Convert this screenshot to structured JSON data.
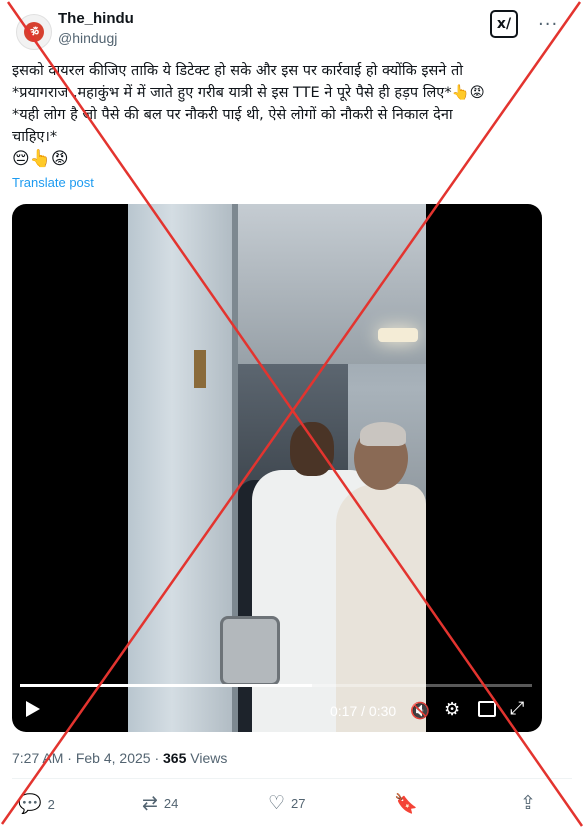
{
  "author": {
    "display_name": "The_hindu",
    "handle": "@hindugj",
    "avatar_icon": "om-logo-icon"
  },
  "toolbar": {
    "grok_label": "x/",
    "more_label": "···"
  },
  "post": {
    "lines": [
      "इसको वायरल कीजिए ताकि ये डिटेक्ट हो सके और इस पर कार्रवाई हो क्योंकि इसने तो",
      "*प्रयागराज ,महाकुंभ में में जाते हुए गरीब यात्री से इस TTE ने पूरे पैसे ही हड़प लिए*👆😡",
      "*यही लोग है जो पैसे की बल पर नौकरी पाई थी, ऐसे लोगों को नौकरी से निकाल देना",
      "चाहिए।*",
      "😔👆😡"
    ],
    "translate_label": "Translate post"
  },
  "video": {
    "time_display": "0:17 / 0:30",
    "progress": 0.57
  },
  "meta": {
    "time": "7:27 AM",
    "separator": " · ",
    "date": "Feb 4, 2025",
    "views_count": "365",
    "views_label": " Views"
  },
  "actions": {
    "replies": "2",
    "reposts": "24",
    "likes": "27"
  },
  "overlay": {
    "cross_color": "#e3342f"
  }
}
